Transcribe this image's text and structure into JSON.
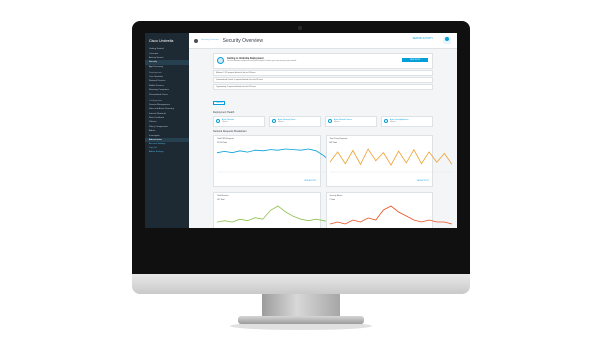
{
  "sidebar": {
    "brand": "Cisco Umbrella",
    "items_top": [
      "Getting Started",
      "Overview",
      "Activity Search",
      "Security",
      "App Discovery"
    ],
    "section_deploy": "Deployments",
    "items_deploy": [
      "Core Identities",
      "Network Devices",
      "Mobile Devices",
      "Roaming Computers",
      "Chromebook Users"
    ],
    "section_config": "Configuration",
    "items_config": [
      "Domain Management",
      "Sites and Active Directory",
      "Internal Networks",
      "Root Certificate",
      "Policies",
      "Policy Components",
      "Admin",
      "Investigate"
    ],
    "account_name": "Administrator",
    "links": [
      "Account Settings",
      "Log Out",
      "Admin Settings"
    ]
  },
  "topbar": {
    "breadcrumb": "Security Overview",
    "title": "Security Overview",
    "search_link": "SEARCH ACTIVITY"
  },
  "banner": {
    "title": "Getting to Umbrella Deployment",
    "text": "You have identities configured but no policies applied. Continue your setup to protect your network.",
    "button": "VIEW SETUP"
  },
  "notices": [
    "Malware: 1,113 requests blocked in the last 24 hours",
    "Command and Control: 0 requests blocked in the last 24 hours",
    "Cryptomining: 0 requests blocked in the last 24 hours"
  ],
  "range_button": "Last 24h",
  "deployment_section": "Deployment Health",
  "health": [
    {
      "name": "Active Networks",
      "value": "1 Active"
    },
    {
      "name": "Active Roaming Clients",
      "value": "0 Active"
    },
    {
      "name": "Active Network Devices",
      "value": "0 Active"
    },
    {
      "name": "Active Virtual Appliances",
      "value": "0 Active"
    }
  ],
  "requests_section": "Network Requests Breakdown",
  "cards": [
    {
      "title": "Total DNS Requests",
      "value": "22,153 Total",
      "foot": "VIEW ACTIVITY",
      "color": "#049fd9",
      "series": [
        30,
        32,
        30,
        33,
        31,
        34,
        33,
        35,
        34,
        36,
        35,
        34,
        36,
        33,
        25,
        14,
        4
      ]
    },
    {
      "title": "Total Proxy Requests",
      "value": "862 Total",
      "foot": "VIEW ACTIVITY",
      "color": "#ee9f2b",
      "series": [
        12,
        26,
        10,
        28,
        9,
        30,
        14,
        25,
        8,
        27,
        11,
        29,
        10,
        26,
        12,
        24,
        9
      ]
    },
    {
      "title": "Total Blocked",
      "value": "107 Total",
      "foot": "",
      "color": "#8cc14a",
      "series": [
        4,
        5,
        4,
        6,
        5,
        7,
        6,
        12,
        15,
        11,
        8,
        6,
        5,
        6,
        5,
        4,
        5
      ]
    },
    {
      "title": "Security Blocks",
      "value": "2 Total",
      "foot": "",
      "color": "#e8501f",
      "series": [
        2,
        3,
        2,
        4,
        3,
        5,
        4,
        9,
        11,
        8,
        6,
        4,
        3,
        4,
        3,
        3,
        2
      ]
    }
  ],
  "chart_data": [
    {
      "type": "line",
      "title": "Total DNS Requests",
      "series": [
        {
          "values": [
            30,
            32,
            30,
            33,
            31,
            34,
            33,
            35,
            34,
            36,
            35,
            34,
            36,
            33,
            25,
            14,
            4
          ]
        }
      ]
    },
    {
      "type": "line",
      "title": "Total Proxy Requests",
      "series": [
        {
          "values": [
            12,
            26,
            10,
            28,
            9,
            30,
            14,
            25,
            8,
            27,
            11,
            29,
            10,
            26,
            12,
            24,
            9
          ]
        }
      ]
    },
    {
      "type": "line",
      "title": "Total Blocked",
      "series": [
        {
          "values": [
            4,
            5,
            4,
            6,
            5,
            7,
            6,
            12,
            15,
            11,
            8,
            6,
            5,
            6,
            5,
            4,
            5
          ]
        }
      ]
    },
    {
      "type": "line",
      "title": "Security Blocks",
      "series": [
        {
          "values": [
            2,
            3,
            2,
            4,
            3,
            5,
            4,
            9,
            11,
            8,
            6,
            4,
            3,
            4,
            3,
            3,
            2
          ]
        }
      ]
    }
  ]
}
